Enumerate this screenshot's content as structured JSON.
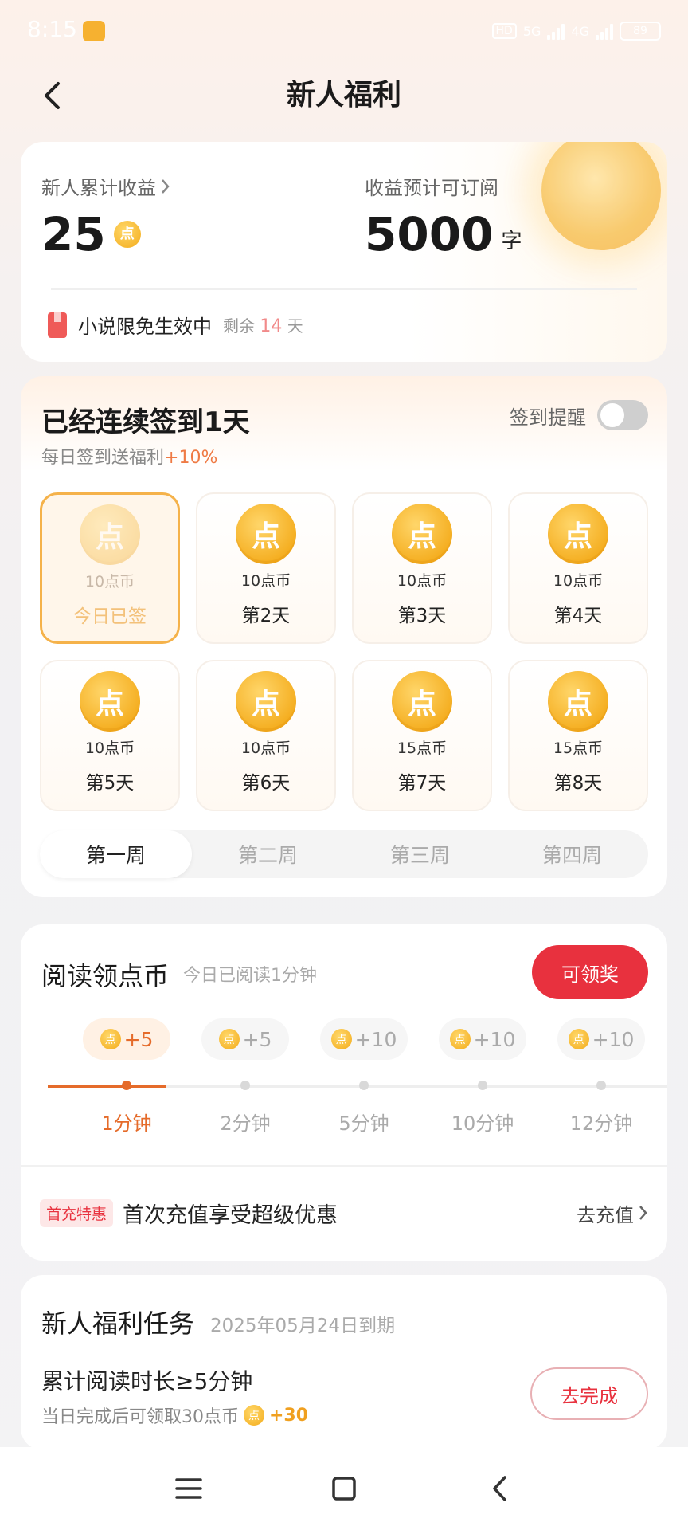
{
  "status_bar": {
    "time": "8:15",
    "hd": "HD",
    "network_1": "5G",
    "network_2": "4G",
    "battery": "89"
  },
  "nav": {
    "title": "新人福利"
  },
  "earnings": {
    "total_label": "新人累计收益",
    "total_value": "25",
    "subscribe_label": "收益预计可订阅",
    "subscribe_value": "5000",
    "subscribe_unit": "字",
    "free_text": "小说限免生效中",
    "remain_prefix": "剩余",
    "remain_days": "14",
    "remain_suffix": "天"
  },
  "signin": {
    "title": "已经连续签到1天",
    "subtitle_text": "每日签到送福利",
    "subtitle_highlight": "+10%",
    "reminder_label": "签到提醒",
    "days": [
      {
        "amount": "10点币",
        "label": "今日已签"
      },
      {
        "amount": "10点币",
        "label": "第2天"
      },
      {
        "amount": "10点币",
        "label": "第3天"
      },
      {
        "amount": "10点币",
        "label": "第4天"
      },
      {
        "amount": "10点币",
        "label": "第5天"
      },
      {
        "amount": "10点币",
        "label": "第6天"
      },
      {
        "amount": "15点币",
        "label": "第7天"
      },
      {
        "amount": "15点币",
        "label": "第8天"
      }
    ],
    "weeks": [
      "第一周",
      "第二周",
      "第三周",
      "第四周"
    ]
  },
  "reading": {
    "title": "阅读领点币",
    "subtitle": "今日已阅读1分钟",
    "claim_button": "可领奖",
    "steps": [
      {
        "reward": "+5",
        "time": "1分钟"
      },
      {
        "reward": "+5",
        "time": "2分钟"
      },
      {
        "reward": "+10",
        "time": "5分钟"
      },
      {
        "reward": "+10",
        "time": "10分钟"
      },
      {
        "reward": "+10",
        "time": "12分钟"
      }
    ],
    "recharge_badge": "首充特惠",
    "recharge_text": "首次充值享受超级优惠",
    "recharge_link": "去充值"
  },
  "tasks": {
    "title": "新人福利任务",
    "expire": "2025年05月24日到期",
    "task_name": "累计阅读时长≥5分钟",
    "task_desc": "当日完成后可领取30点币",
    "task_reward": "+30",
    "task_button": "去完成"
  },
  "coin_glyph": "点",
  "colors": {
    "accent_red": "#e8313e",
    "accent_orange": "#e56b2a",
    "coin_gold": "#f4ac1d"
  }
}
